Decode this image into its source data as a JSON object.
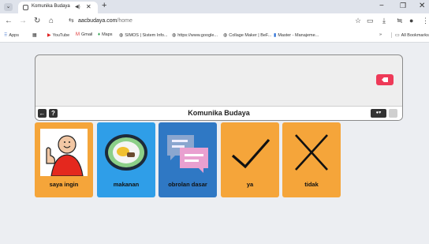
{
  "browser": {
    "tab_title": "Komunika Budaya",
    "url_domain": "aacbudaya.com",
    "url_path": "/home",
    "bookmarks": [
      {
        "icon": "apps-grid-icon",
        "label": "Apps"
      },
      {
        "icon": "youtube-icon",
        "label": "YouTube"
      },
      {
        "icon": "gmail-icon",
        "label": "Gmail"
      },
      {
        "icon": "maps-pin-icon",
        "label": "Maps"
      },
      {
        "icon": "globe-icon",
        "label": "SIMOS | Sistem Info..."
      },
      {
        "icon": "globe-icon",
        "label": "https://www.google..."
      },
      {
        "icon": "globe-icon",
        "label": "Collage Maker | BeF..."
      },
      {
        "icon": "document-icon",
        "label": "Master - Manajeme..."
      }
    ],
    "all_bookmarks": "All Bookmarks"
  },
  "app": {
    "title": "Komunika Budaya",
    "tiles": [
      {
        "label": "saya ingin",
        "color": "#f5a53a",
        "icon": "person-thumbs-up-icon"
      },
      {
        "label": "makanan",
        "color": "#2f9ee8",
        "icon": "food-plate-icon"
      },
      {
        "label": "obrolan dasar",
        "color": "#2f78c4",
        "icon": "chat-bubbles-icon"
      },
      {
        "label": "ya",
        "color": "#f5a53a",
        "icon": "checkmark-icon"
      },
      {
        "label": "tidak",
        "color": "#f5a53a",
        "icon": "cross-icon"
      }
    ]
  }
}
